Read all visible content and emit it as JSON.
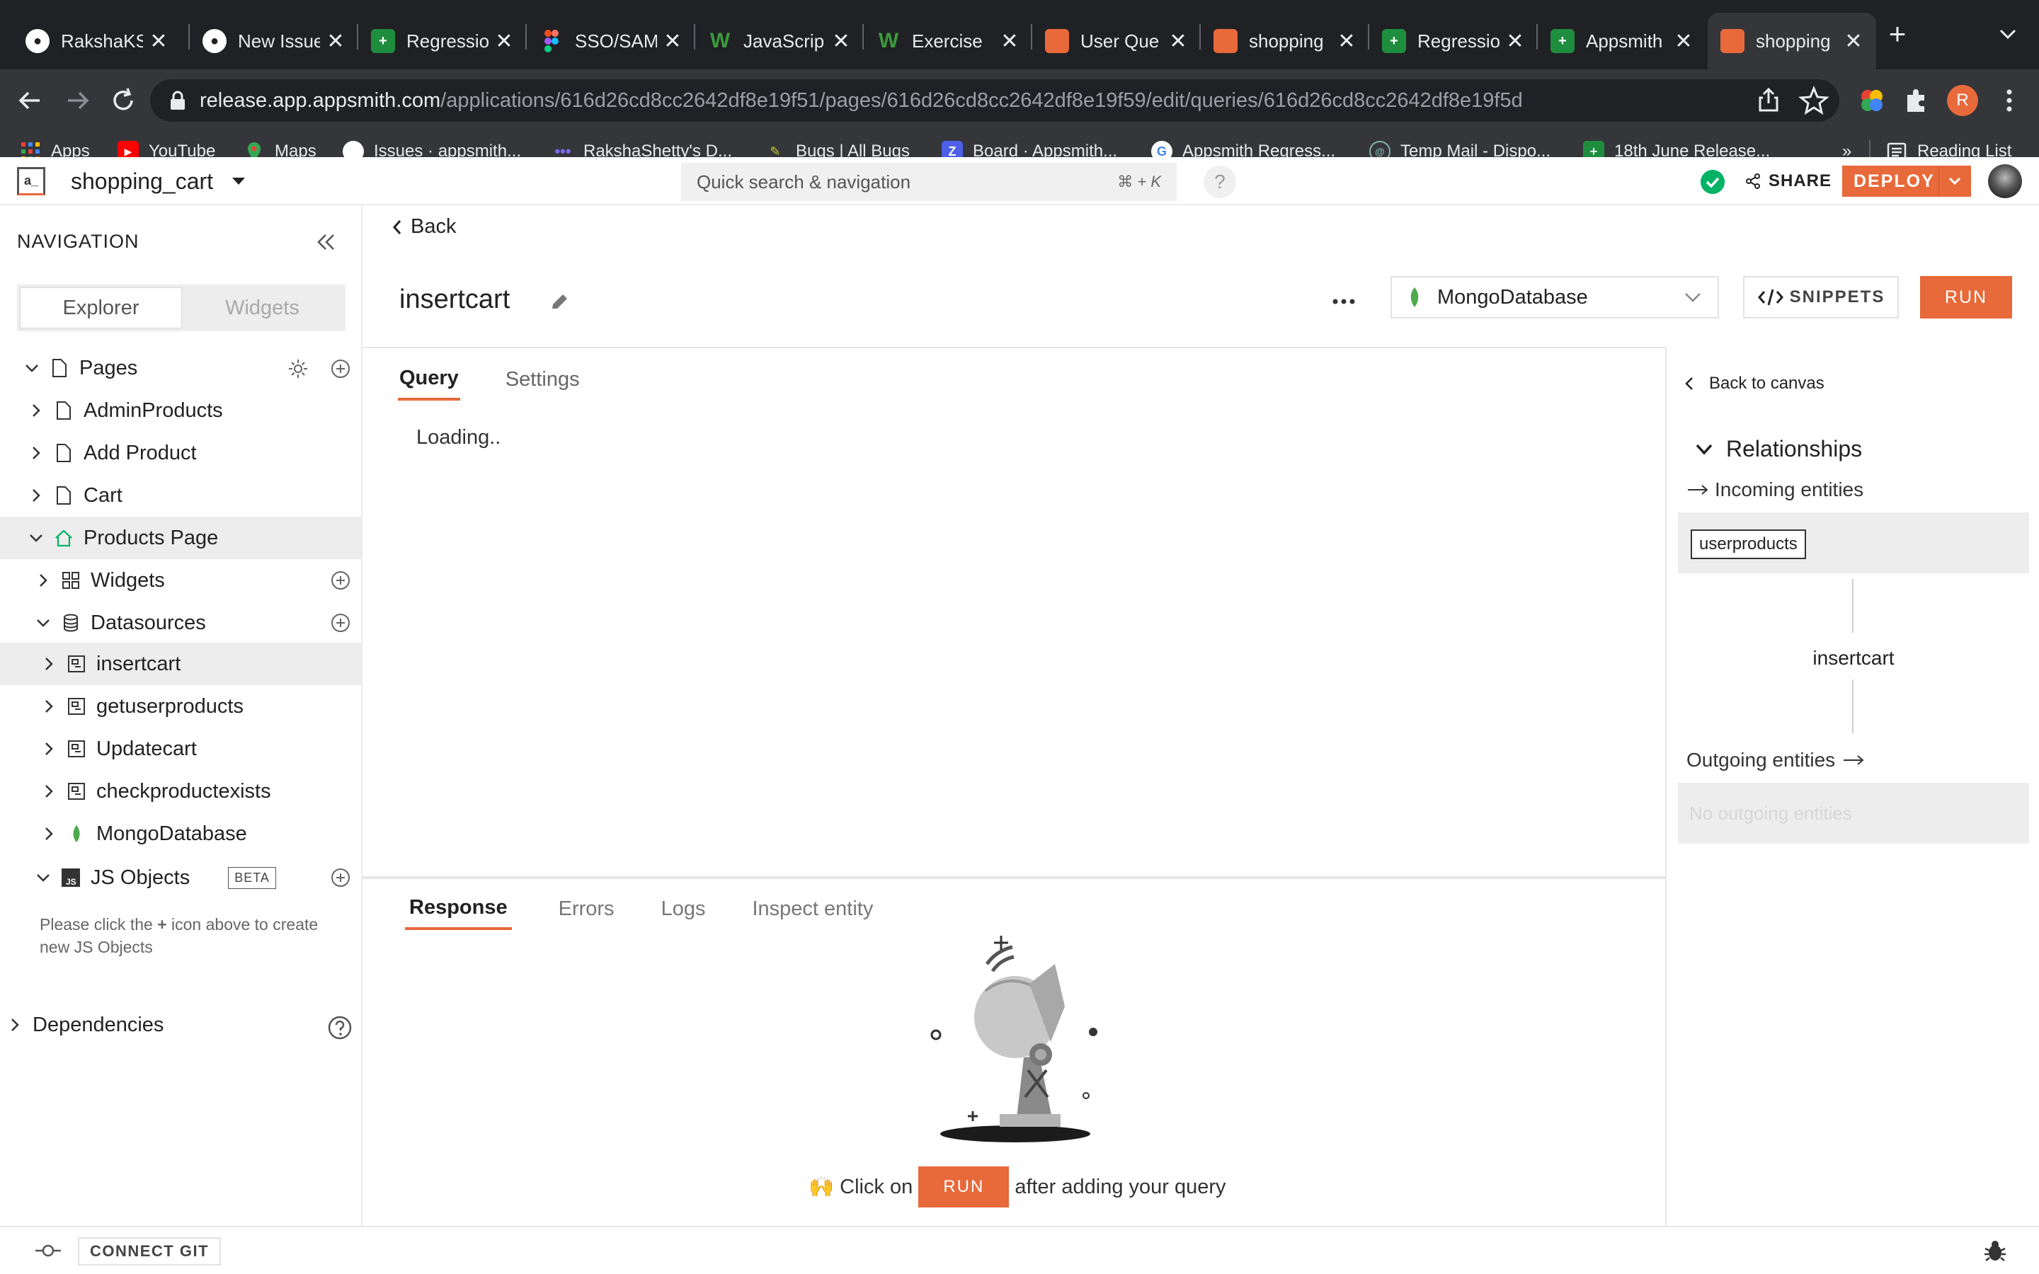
{
  "browser": {
    "tabs": [
      {
        "title": "RakshaKS",
        "favicon": "github-icon"
      },
      {
        "title": "New Issue",
        "favicon": "github-icon"
      },
      {
        "title": "Regressio",
        "favicon": "sheets-icon"
      },
      {
        "title": "SSO/SAM",
        "favicon": "figma-icon"
      },
      {
        "title": "JavaScrip",
        "favicon": "w-icon"
      },
      {
        "title": "Exercise",
        "favicon": "w-icon"
      },
      {
        "title": "User Que",
        "favicon": "appsmith-icon"
      },
      {
        "title": "shopping",
        "favicon": "appsmith-icon"
      },
      {
        "title": "Regressio",
        "favicon": "sheets-icon"
      },
      {
        "title": "Appsmith",
        "favicon": "sheets-icon"
      },
      {
        "title": "shopping",
        "favicon": "appsmith-icon",
        "active": true
      }
    ],
    "url_host": "release.app.appsmith.com",
    "url_path": "/applications/616d26cd8cc2642df8e19f51/pages/616d26cd8cc2642df8e19f59/edit/queries/616d26cd8cc2642df8e19f5d",
    "profile_initial": "R",
    "bookmarks": [
      {
        "label": "Apps",
        "icon": "apps-grid-icon"
      },
      {
        "label": "YouTube",
        "icon": "youtube-icon"
      },
      {
        "label": "Maps",
        "icon": "maps-icon"
      },
      {
        "label": "Issues · appsmith...",
        "icon": "github-icon"
      },
      {
        "label": "RakshaShetty's D...",
        "icon": "dots-icon"
      },
      {
        "label": "Bugs | All Bugs",
        "icon": "bug-icon"
      },
      {
        "label": "Board · Appsmith...",
        "icon": "zenhub-icon"
      },
      {
        "label": "Appsmith Regress...",
        "icon": "google-icon"
      },
      {
        "label": "Temp Mail - Dispo...",
        "icon": "tempmail-icon"
      },
      {
        "label": "18th June Release...",
        "icon": "sheets-icon"
      }
    ],
    "bookmarks_overflow": "»",
    "reading_list": "Reading List"
  },
  "header": {
    "app_name": "shopping_cart",
    "search_placeholder": "Quick search & navigation",
    "search_shortcut": "⌘ + K",
    "help": "?",
    "share": "SHARE",
    "deploy": "DEPLOY"
  },
  "sidebar": {
    "heading": "NAVIGATION",
    "tabs": [
      "Explorer",
      "Widgets"
    ],
    "pages_label": "Pages",
    "pages": [
      "AdminProducts",
      "Add Product",
      "Cart",
      "Products Page"
    ],
    "widgets_label": "Widgets",
    "datasources_label": "Datasources",
    "queries": [
      "insertcart",
      "getuserproducts",
      "Updatecart",
      "checkproductexists"
    ],
    "datasource": "MongoDatabase",
    "js_objects_label": "JS Objects",
    "beta": "BETA",
    "js_hint_part1": "Please click the ",
    "js_hint_plus": "+",
    "js_hint_part2": " icon above to create new JS Objects",
    "dependencies_label": "Dependencies"
  },
  "editor": {
    "back": "Back",
    "query_name": "insertcart",
    "datasource_selected": "MongoDatabase",
    "snippets": "SNIPPETS",
    "run": "RUN",
    "tabs": [
      "Query",
      "Settings"
    ],
    "loading": "Loading.."
  },
  "response": {
    "tabs": [
      "Response",
      "Errors",
      "Logs",
      "Inspect entity"
    ],
    "hint_prefix": "🙌 Click on",
    "hint_run": "RUN",
    "hint_suffix": "after adding your query"
  },
  "relationships": {
    "back_to_canvas": "Back to canvas",
    "heading": "Relationships",
    "incoming_label": "Incoming entities",
    "incoming": [
      "userproducts"
    ],
    "current": "insertcart",
    "outgoing_label": "Outgoing entities",
    "outgoing_empty": "No outgoing entities"
  },
  "footer": {
    "connect_git": "CONNECT GIT"
  },
  "colors": {
    "accent": "#e8693a",
    "saved": "#03b365",
    "mongo": "#4fa94d"
  }
}
